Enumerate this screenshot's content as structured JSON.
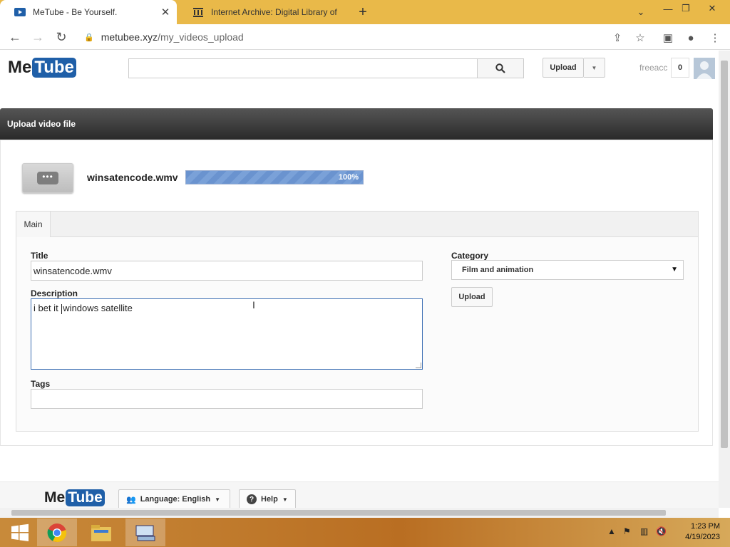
{
  "browser": {
    "tabs": [
      {
        "title": "MeTube - Be Yourself.",
        "active": true
      },
      {
        "title": "Internet Archive: Digital Library of",
        "active": false
      }
    ],
    "url_domain": "metubee.xyz",
    "url_path": "/my_videos_upload"
  },
  "site": {
    "logo_me": "Me",
    "logo_tube": "Tube",
    "search_placeholder": "",
    "upload_label": "Upload",
    "username": "freeacc",
    "notification_count": "0"
  },
  "upload": {
    "header_title": "Upload video file",
    "file_name": "winsatencode.wmv",
    "progress_percent": 100,
    "progress_label": "100%",
    "tabs": [
      "Main"
    ],
    "title_label": "Title",
    "title_value": "winsatencode.wmv",
    "description_label": "Description",
    "description_value": "i bet it windows satellite",
    "tags_label": "Tags",
    "tags_value": "",
    "category_label": "Category",
    "category_value": "Film and animation",
    "upload_button": "Upload"
  },
  "footer": {
    "logo_me": "Me",
    "logo_tube": "Tube",
    "language_label": "Language: English",
    "help_label": "Help"
  },
  "taskbar": {
    "time": "1:23 PM",
    "date": "4/19/2023"
  },
  "colors": {
    "brand_blue": "#1f5fa8",
    "header_dark": "#2a2a2a",
    "progress_fill": "#6a93cf",
    "browser_frame": "#e9b949"
  }
}
